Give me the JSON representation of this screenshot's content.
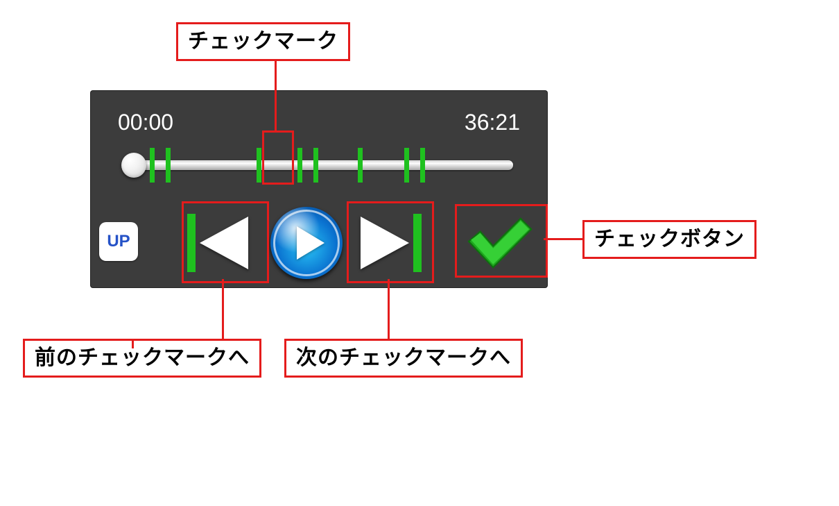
{
  "annotations": {
    "checkmark": "チェックマーク",
    "check_button": "チェックボタン",
    "prev_mark": "前のチェックマークへ",
    "next_mark": "次のチェックマークへ"
  },
  "player": {
    "current_time": "00:00",
    "total_time": "36:21",
    "up_label": "UP",
    "mark_positions_pct": [
      6.5,
      10.5,
      34.0,
      44.5,
      48.5,
      60.0,
      72.0,
      76.0
    ]
  },
  "colors": {
    "panel_bg": "#3c3c3c",
    "mark_green": "#1fc11f",
    "callout_red": "#e41c1c",
    "up_text": "#2552c7"
  }
}
